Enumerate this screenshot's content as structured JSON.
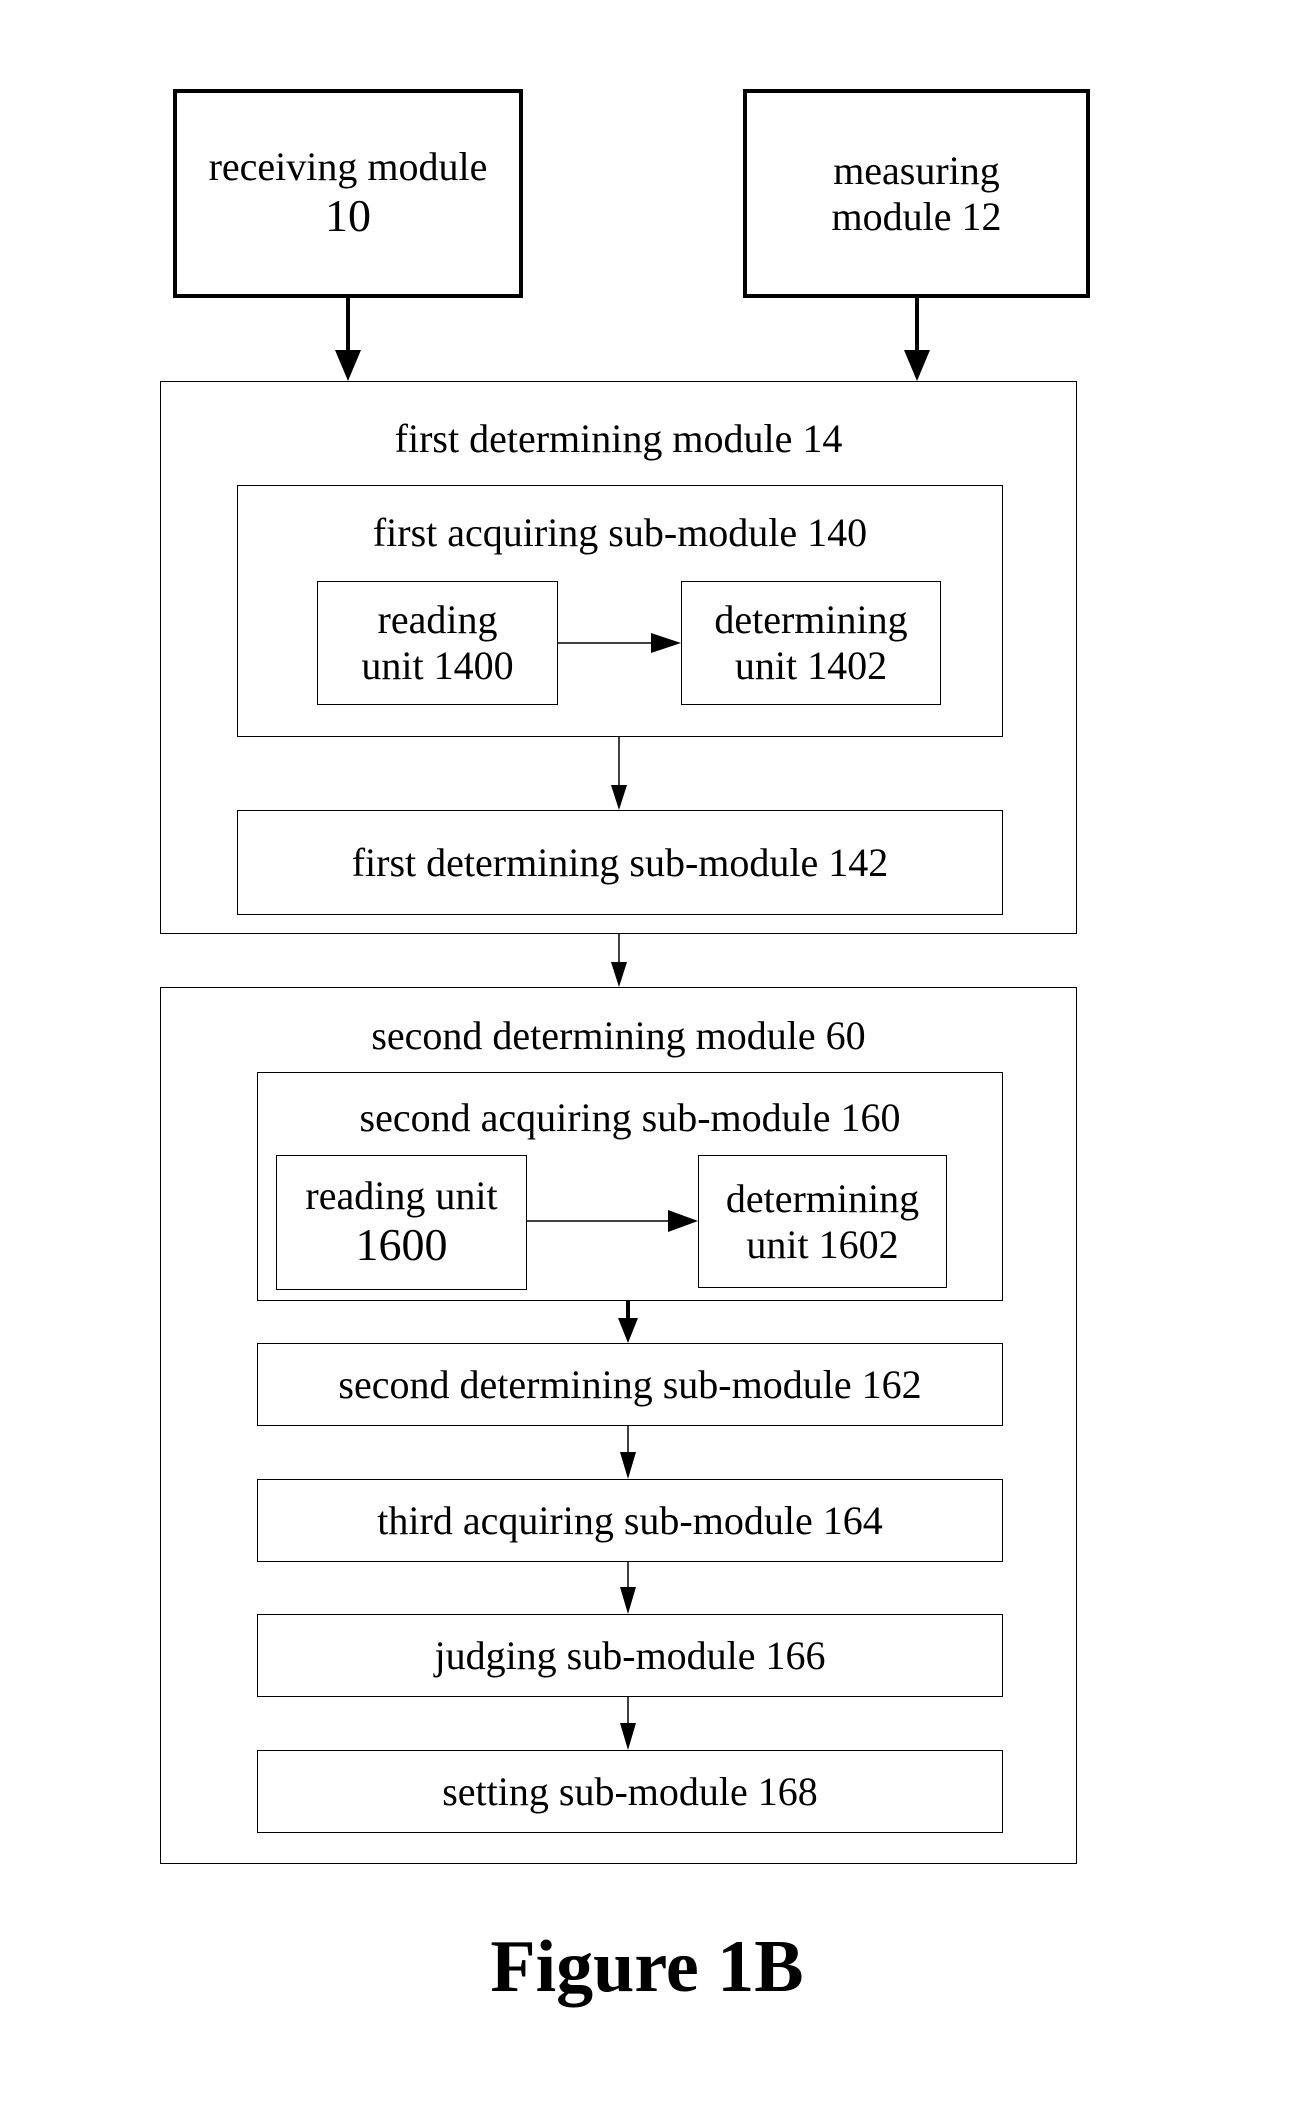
{
  "receiving_module": {
    "line1": "receiving module",
    "line2": "10"
  },
  "measuring_module": {
    "line1": "measuring",
    "line2": "module 12"
  },
  "first_determining_module": {
    "title": "first determining module 14",
    "first_acquiring_sub_module": {
      "title": "first acquiring sub-module 140",
      "reading_unit": {
        "line1": "reading",
        "line2": "unit 1400"
      },
      "determining_unit": {
        "line1": "determining",
        "line2": "unit 1402"
      }
    },
    "first_determining_sub_module": {
      "title": "first determining sub-module 142"
    }
  },
  "second_determining_module": {
    "title": "second determining module 60",
    "second_acquiring_sub_module": {
      "title": "second acquiring sub-module 160",
      "reading_unit": {
        "line1": "reading unit",
        "line2": "1600"
      },
      "determining_unit": {
        "line1": "determining",
        "line2": "unit 1602"
      }
    },
    "second_determining_sub_module": {
      "title": "second determining sub-module 162"
    },
    "third_acquiring_sub_module": {
      "title": "third acquiring sub-module 164"
    },
    "judging_sub_module": {
      "title": "judging sub-module 166"
    },
    "setting_sub_module": {
      "title": "setting sub-module 168"
    }
  },
  "caption": "Figure 1B"
}
